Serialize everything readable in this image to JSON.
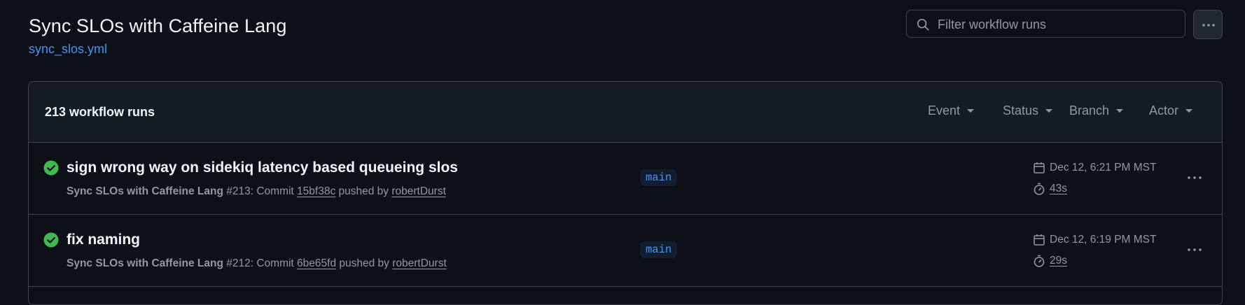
{
  "page": {
    "title": "Sync SLOs with Caffeine Lang",
    "workflow_file": "sync_slos.yml"
  },
  "search": {
    "placeholder": "Filter workflow runs",
    "value": ""
  },
  "runs_header": {
    "count_label": "213 workflow runs",
    "filters": [
      "Event",
      "Status",
      "Branch",
      "Actor"
    ]
  },
  "runs": [
    {
      "title": "sign wrong way on sidekiq latency based queueing slos",
      "workflow": "Sync SLOs with Caffeine Lang",
      "run_number": "#213",
      "commit_prefix": ": Commit ",
      "commit": "15bf38c",
      "pushed_by": " pushed by ",
      "actor": "robertDurst",
      "branch": "main",
      "date": "Dec 12, 6:21 PM MST",
      "duration": "43s",
      "status": "success"
    },
    {
      "title": "fix naming",
      "workflow": "Sync SLOs with Caffeine Lang",
      "run_number": "#212",
      "commit_prefix": ": Commit ",
      "commit": "6be65fd",
      "pushed_by": " pushed by ",
      "actor": "robertDurst",
      "branch": "main",
      "date": "Dec 12, 6:19 PM MST",
      "duration": "29s",
      "status": "success"
    }
  ],
  "colors": {
    "background": "#0d1117",
    "header_bg": "#151b23",
    "border": "#3d444d",
    "link": "#4493f8",
    "success": "#3fb950",
    "muted_text": "#9198a1"
  },
  "icons": {
    "search": "search-icon",
    "kebab": "kebab-horizontal-icon",
    "status": "check-circle-fill-icon",
    "date": "calendar-icon",
    "duration": "stopwatch-icon",
    "caret": "triangle-down-icon"
  }
}
